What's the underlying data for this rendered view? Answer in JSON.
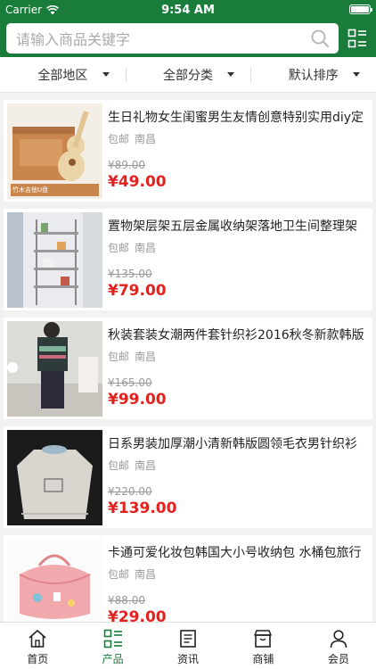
{
  "status": {
    "carrier": "Carrier",
    "time": "9:54 AM"
  },
  "search": {
    "placeholder": "请输入商品关键字"
  },
  "filters": [
    "全部地区",
    "全部分类",
    "默认排序"
  ],
  "products": [
    {
      "title": "生日礼物女生闺蜜男生友情创意特别实用diy定",
      "shipping": "包邮",
      "location": "南昌",
      "original_price": "¥89.00",
      "price": "¥49.00",
      "image_caption": "竹木吉他U盘"
    },
    {
      "title": "置物架层架五层金属收纳架落地卫生间整理架",
      "shipping": "包邮",
      "location": "南昌",
      "original_price": "¥135.00",
      "price": "¥79.00"
    },
    {
      "title": "秋装套装女潮两件套针织衫2016秋冬新款韩版",
      "shipping": "包邮",
      "location": "南昌",
      "original_price": "¥165.00",
      "price": "¥99.00"
    },
    {
      "title": "日系男装加厚潮小清新韩版圆领毛衣男针织衫",
      "shipping": "包邮",
      "location": "南昌",
      "original_price": "¥220.00",
      "price": "¥139.00"
    },
    {
      "title": "卡通可爱化妆包韩国大小号收纳包 水桶包旅行",
      "shipping": "包邮",
      "location": "南昌",
      "original_price": "¥88.00",
      "price": "¥29.00"
    }
  ],
  "tabs": [
    {
      "label": "首页",
      "icon": "home-icon"
    },
    {
      "label": "产品",
      "icon": "product-list-icon",
      "active": true
    },
    {
      "label": "资讯",
      "icon": "news-icon"
    },
    {
      "label": "商铺",
      "icon": "shop-icon"
    },
    {
      "label": "会员",
      "icon": "member-icon"
    }
  ],
  "colors": {
    "brand_green": "#1a7c3a",
    "price_red": "#e1221e",
    "background": "#f2f2f2"
  }
}
